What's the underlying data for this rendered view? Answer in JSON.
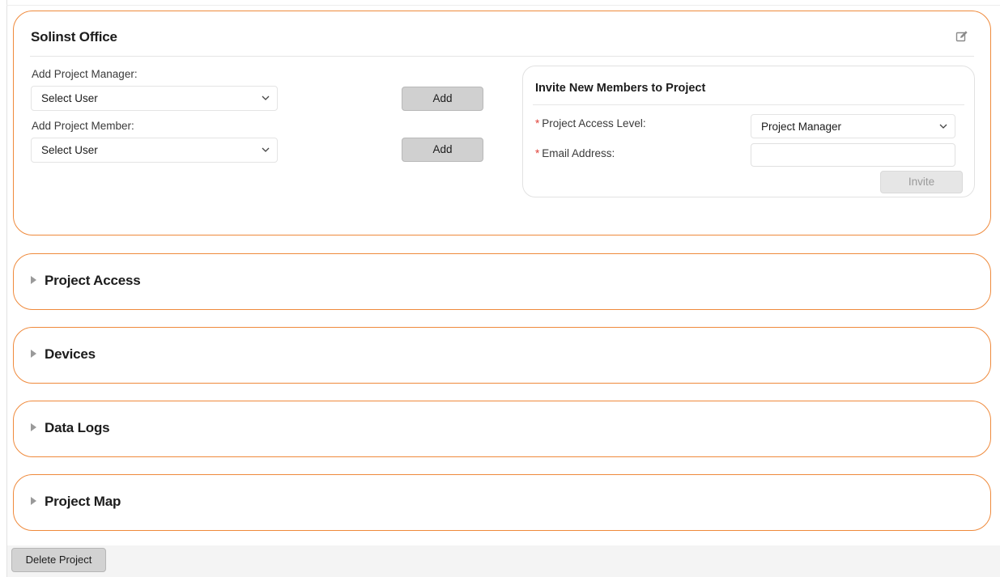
{
  "project": {
    "title": "Solinst Office",
    "edit_icon": "edit-icon",
    "add_manager": {
      "label": "Add Project Manager:",
      "select_value": "Select User",
      "button_label": "Add"
    },
    "add_member": {
      "label": "Add Project Member:",
      "select_value": "Select User",
      "button_label": "Add"
    },
    "invite": {
      "title": "Invite New Members to Project",
      "required_marker": "*",
      "access_level_label": "Project Access Level:",
      "access_level_value": "Project Manager",
      "email_label": "Email Address:",
      "email_value": "",
      "email_placeholder": "",
      "button_label": "Invite"
    }
  },
  "sections": [
    {
      "title": "Project Access",
      "icon": "caret-right-icon",
      "expanded": false
    },
    {
      "title": "Devices",
      "icon": "caret-right-icon",
      "expanded": false
    },
    {
      "title": "Data Logs",
      "icon": "caret-right-icon",
      "expanded": false
    },
    {
      "title": "Project Map",
      "icon": "caret-right-icon",
      "expanded": false
    }
  ],
  "footer": {
    "delete_label": "Delete Project"
  },
  "colors": {
    "accent": "#ef8a3c",
    "required": "#e0433a",
    "button_bg": "#d0d0d0",
    "disabled_button_bg": "#e6e6e6"
  }
}
